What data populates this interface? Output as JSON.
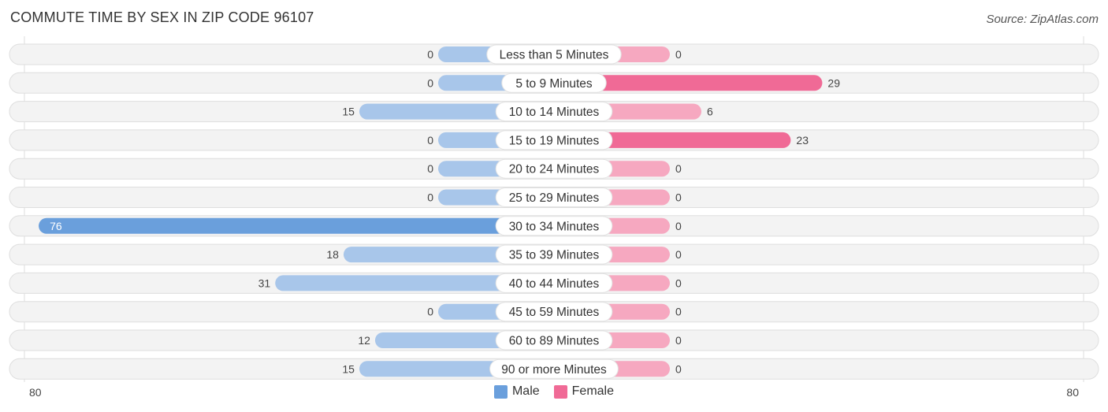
{
  "header": {
    "title": "COMMUTE TIME BY SEX IN ZIP CODE 96107",
    "source": "Source: ZipAtlas.com"
  },
  "colors": {
    "male_strong": "#6a9fdc",
    "male_light": "#a8c6ea",
    "female_strong": "#f06a96",
    "female_light": "#f6a8c0",
    "row_bg": "#f3f3f3"
  },
  "chart_data": {
    "type": "bar",
    "orientation": "horizontal-diverging",
    "title": "COMMUTE TIME BY SEX IN ZIP CODE 96107",
    "categories": [
      "Less than 5 Minutes",
      "5 to 9 Minutes",
      "10 to 14 Minutes",
      "15 to 19 Minutes",
      "20 to 24 Minutes",
      "25 to 29 Minutes",
      "30 to 34 Minutes",
      "35 to 39 Minutes",
      "40 to 44 Minutes",
      "45 to 59 Minutes",
      "60 to 89 Minutes",
      "90 or more Minutes"
    ],
    "series": [
      {
        "name": "Male",
        "values": [
          0,
          0,
          15,
          0,
          0,
          0,
          76,
          18,
          31,
          0,
          12,
          15
        ]
      },
      {
        "name": "Female",
        "values": [
          0,
          29,
          6,
          23,
          0,
          0,
          0,
          0,
          0,
          0,
          0,
          0
        ]
      }
    ],
    "axis": {
      "left_label": "80",
      "right_label": "80",
      "range": [
        80,
        80
      ]
    },
    "legend": {
      "position": "bottom-center",
      "entries": [
        "Male",
        "Female"
      ]
    }
  }
}
